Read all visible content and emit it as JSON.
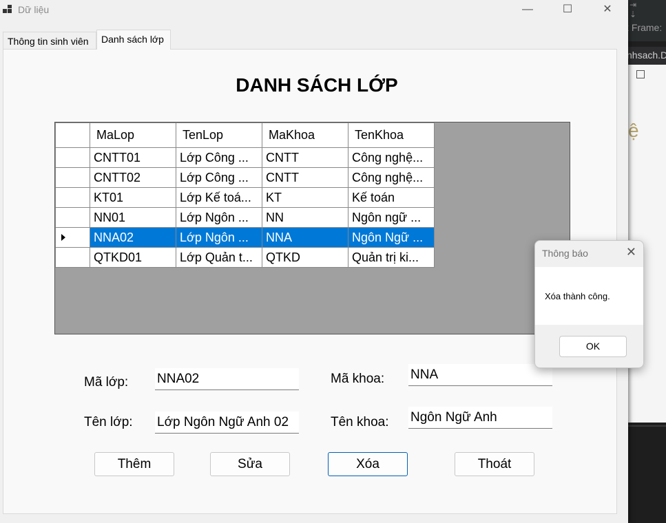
{
  "background_app": {
    "frame_label": "k Frame:",
    "tab_label": "nhsach.D"
  },
  "window": {
    "title": "Dữ liệu",
    "minimize_glyph": "—",
    "maximize_glyph": "☐",
    "close_glyph": "✕"
  },
  "tabs": [
    {
      "label": "Thông tin sinh viên",
      "active": false
    },
    {
      "label": "Danh sách lớp",
      "active": true
    }
  ],
  "heading": "DANH SÁCH LỚP",
  "grid": {
    "columns": [
      "MaLop",
      "TenLop",
      "MaKhoa",
      "TenKhoa"
    ],
    "rows": [
      [
        "CNTT01",
        "Lớp Công ...",
        "CNTT",
        "Công nghệ..."
      ],
      [
        "CNTT02",
        "Lớp Công ...",
        "CNTT",
        "Công nghệ..."
      ],
      [
        "KT01",
        "Lớp Kế toá...",
        "KT",
        "Kế toán"
      ],
      [
        "NN01",
        "Lớp Ngôn ...",
        "NN",
        "Ngôn ngữ ..."
      ],
      [
        "NNA02",
        "Lớp Ngôn ...",
        "NNA",
        "Ngôn Ngữ ..."
      ],
      [
        "QTKD01",
        "Lớp Quản t...",
        "QTKD",
        "Quản trị ki..."
      ]
    ],
    "selected_row_index": 4,
    "selection_color": "#0078d7"
  },
  "form": {
    "ma_lop_label": "Mã lớp:",
    "ma_lop_value": "NNA02",
    "ten_lop_label": "Tên lớp:",
    "ten_lop_value": "Lớp Ngôn Ngữ Anh 02",
    "ma_khoa_label": "Mã khoa:",
    "ma_khoa_value": "NNA",
    "ten_khoa_label": "Tên khoa:",
    "ten_khoa_value": "Ngôn Ngữ Anh"
  },
  "buttons": {
    "add": "Thêm",
    "edit": "Sửa",
    "delete": "Xóa",
    "exit": "Thoát"
  },
  "dialog": {
    "title": "Thông báo",
    "close_glyph": "✕",
    "message": "Xóa thành công.",
    "ok_label": "OK"
  }
}
